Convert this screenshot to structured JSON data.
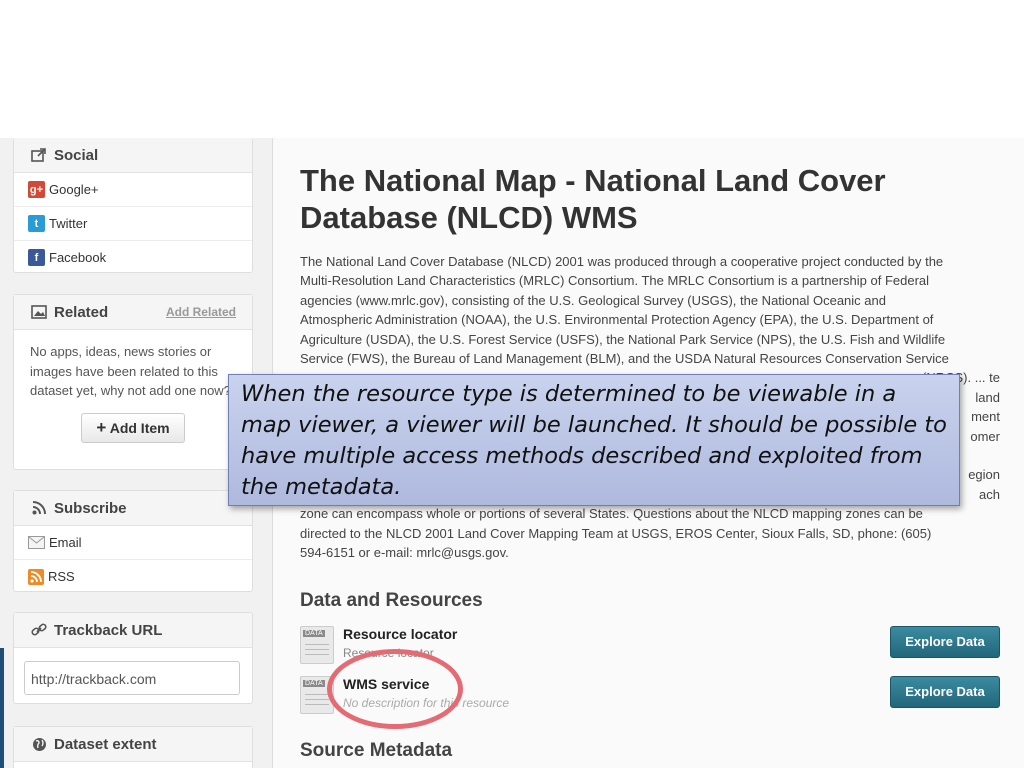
{
  "sidebar": {
    "social": {
      "title": "Social",
      "items": [
        {
          "label": "Google+",
          "icon": "google-plus-icon",
          "color": "#d34836",
          "glyph": "g+"
        },
        {
          "label": "Twitter",
          "icon": "twitter-icon",
          "color": "#2a9bd6",
          "glyph": "t"
        },
        {
          "label": "Facebook",
          "icon": "facebook-icon",
          "color": "#3b5998",
          "glyph": "f"
        }
      ]
    },
    "related": {
      "title": "Related",
      "add_link": "Add Related",
      "empty_text": "No apps, ideas, news stories or images have been related to this dataset yet, why not add one now?",
      "add_button": "Add Item"
    },
    "subscribe": {
      "title": "Subscribe",
      "items": [
        {
          "label": "Email",
          "icon": "email-icon"
        },
        {
          "label": "RSS",
          "icon": "rss-icon"
        }
      ]
    },
    "trackback": {
      "title": "Trackback URL",
      "value": "http://trackback.com"
    },
    "extent": {
      "title": "Dataset extent"
    }
  },
  "main": {
    "title": "The National Map - National Land Cover Database (NLCD) WMS",
    "description_lines": [
      "The National Land Cover Database (NLCD) 2001 was produced through a cooperative project conducted by the",
      "Multi-Resolution Land Characteristics (MRLC) Consortium. The MRLC Consortium is a partnership of Federal",
      "agencies (www.mrlc.gov), consisting of the U.S. Geological Survey (USGS), the National Oceanic and",
      "Atmospheric Administration (NOAA), the U.S. Environmental Protection Agency (EPA), the U.S. Department of",
      "Agriculture (USDA), the U.S. Forest Service (USFS), the National Park Service (NPS), the U.S. Fish and Wildlife",
      "Service (FWS), the Bureau of Land Management (BLM), and the USDA Natural Resources Conservation Service",
      "(NRCS). ... te",
      "land",
      "ment",
      "omer",
      "",
      "egion",
      "ach",
      "zone can encompass whole or portions of several States. Questions about the NLCD mapping zones can be",
      "directed to the NLCD 2001 Land Cover Mapping Team at USGS, EROS Center, Sioux Falls, SD, phone: (605)",
      "594-6151 or e-mail: mrlc@usgs.gov."
    ],
    "resources_heading": "Data and Resources",
    "resources": [
      {
        "title": "Resource locator",
        "description": "Resource locator",
        "button": "Explore Data",
        "empty": false
      },
      {
        "title": "WMS service",
        "description": "No description for this resource",
        "button": "Explore Data",
        "empty": true
      }
    ],
    "metadata_heading": "Source Metadata"
  },
  "callout": {
    "text": "When the resource type is determined to be viewable in a map viewer, a viewer will be launched. It should be possible to have multiple access methods described and exploited from the metadata."
  },
  "colors": {
    "button": "#2a7387",
    "highlight": "#e46a74",
    "callout_bg": "#bcc6e6"
  }
}
